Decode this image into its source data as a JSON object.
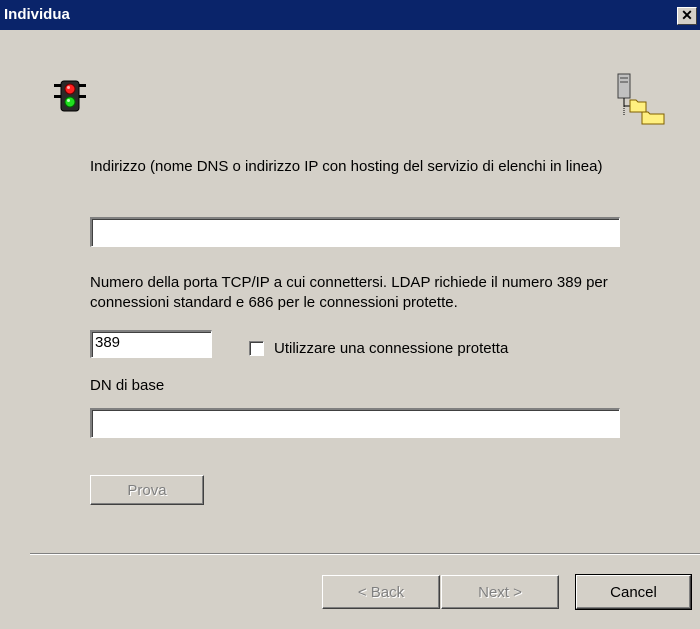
{
  "window": {
    "title": "Individua",
    "close_label": "✕"
  },
  "form": {
    "address_label": "Indirizzo (nome DNS o indirizzo IP con hosting del servizio di elenchi in linea)",
    "address_value": "",
    "port_label": "Numero della porta TCP/IP a cui connettersi. LDAP richiede il numero 389 per connessioni standard e 686 per le connessioni protette.",
    "port_value": "389",
    "secure_label": "Utilizzare una connessione protetta",
    "secure_checked": false,
    "base_dn_label": "DN di base",
    "base_dn_value": "",
    "test_button": "Prova"
  },
  "footer": {
    "back_button": "< Back",
    "next_button": "Next >",
    "cancel_button": "Cancel"
  },
  "icons": {
    "left": "traffic-light-icon",
    "right": "directory-server-icon"
  }
}
